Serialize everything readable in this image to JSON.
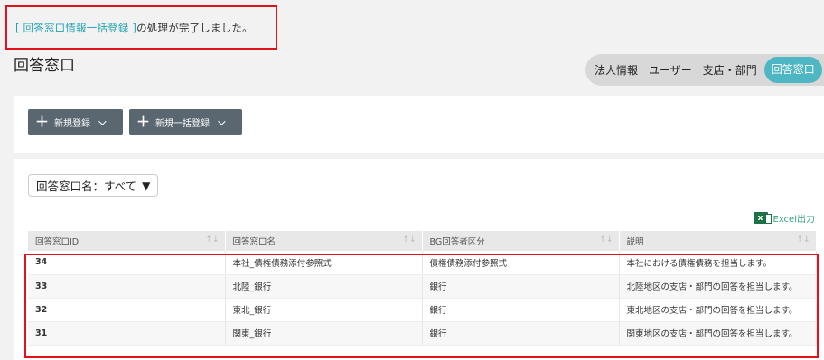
{
  "notice": {
    "link_text": "[ 回答窓口情報一括登録 ]",
    "message": "の処理が完了しました。"
  },
  "page": {
    "title": "回答窓口"
  },
  "tabs": [
    {
      "label": "法人情報"
    },
    {
      "label": "ユーザー"
    },
    {
      "label": "支店・部門"
    },
    {
      "label": "回答窓口",
      "active": true
    }
  ],
  "toolbar": {
    "new_register_label": "新規登録",
    "bulk_register_label": "新規一括登録"
  },
  "filter": {
    "label": "回答窓口名：すべて"
  },
  "export": {
    "label": "Excel出力"
  },
  "table": {
    "columns": [
      "回答窓口ID",
      "回答窓口名",
      "BG回答者区分",
      "説明"
    ],
    "rows": [
      [
        "34",
        "本社_債権債務添付参照式",
        "債権債務添付参照式",
        "本社における債権債務を担当します。"
      ],
      [
        "33",
        "北陸_銀行",
        "銀行",
        "北陸地区の支店・部門の回答を担当します。"
      ],
      [
        "32",
        "東北_銀行",
        "銀行",
        "東北地区の支店・部門の回答を担当します。"
      ],
      [
        "31",
        "関東_銀行",
        "銀行",
        "関東地区の支店・部門の回答を担当します。"
      ]
    ]
  },
  "colors": {
    "accent": "#4fb6c4",
    "link": "#25a5b4",
    "highlight": "#e0131b",
    "button": "#5b6770"
  }
}
